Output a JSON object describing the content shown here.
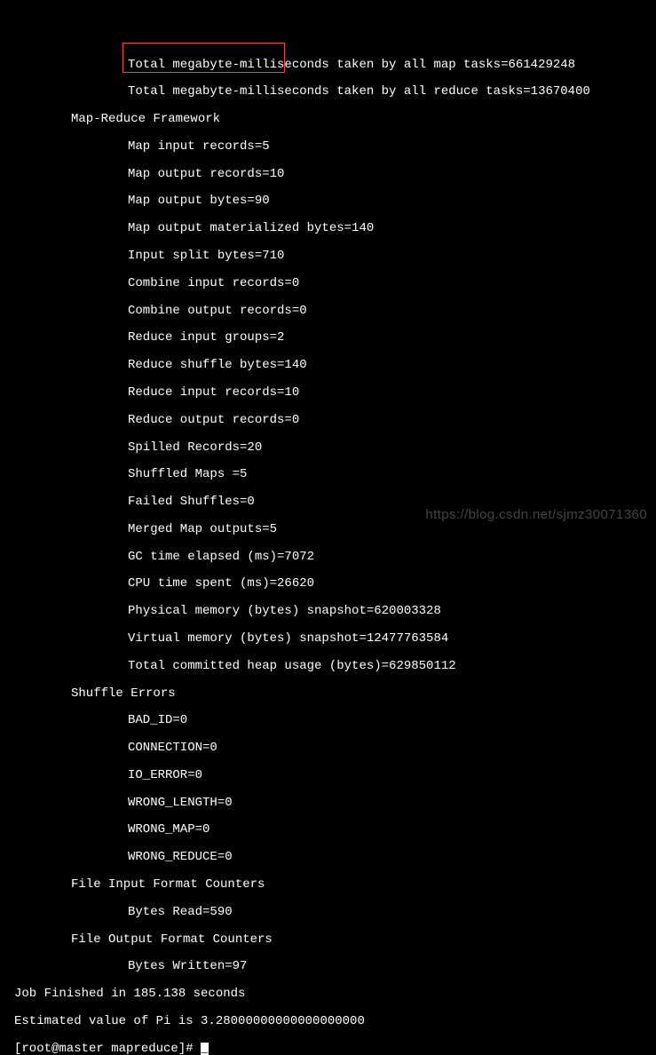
{
  "lines": {
    "l01": "Total megabyte-milliseconds taken by all map tasks=661429248",
    "l02": "Total megabyte-milliseconds taken by all reduce tasks=13670400",
    "l03": "Map-Reduce Framework",
    "l04": "Map input records=5",
    "l05": "Map output records=10",
    "l06": "Map output bytes=90",
    "l07": "Map output materialized bytes=140",
    "l08": "Input split bytes=710",
    "l09": "Combine input records=0",
    "l10": "Combine output records=0",
    "l11": "Reduce input groups=2",
    "l12": "Reduce shuffle bytes=140",
    "l13": "Reduce input records=10",
    "l14": "Reduce output records=0",
    "l15": "Spilled Records=20",
    "l16": "Shuffled Maps =5",
    "l17": "Failed Shuffles=0",
    "l18": "Merged Map outputs=5",
    "l19": "GC time elapsed (ms)=7072",
    "l20": "CPU time spent (ms)=26620",
    "l21": "Physical memory (bytes) snapshot=620003328",
    "l22": "Virtual memory (bytes) snapshot=12477763584",
    "l23": "Total committed heap usage (bytes)=629850112",
    "l24": "Shuffle Errors",
    "l25": "BAD_ID=0",
    "l26": "CONNECTION=0",
    "l27": "IO_ERROR=0",
    "l28": "WRONG_LENGTH=0",
    "l29": "WRONG_MAP=0",
    "l30": "WRONG_REDUCE=0",
    "l31": "File Input Format Counters",
    "l32": "Bytes Read=590",
    "l33": "File Output Format Counters",
    "l34": "Bytes Written=97",
    "l35": "Job Finished in 185.138 seconds",
    "l36": "Estimated value of Pi is 3.28000000000000000000",
    "l37": "[root@master mapreduce]# "
  },
  "watermark": "https://blog.csdn.net/sjmz30071360"
}
